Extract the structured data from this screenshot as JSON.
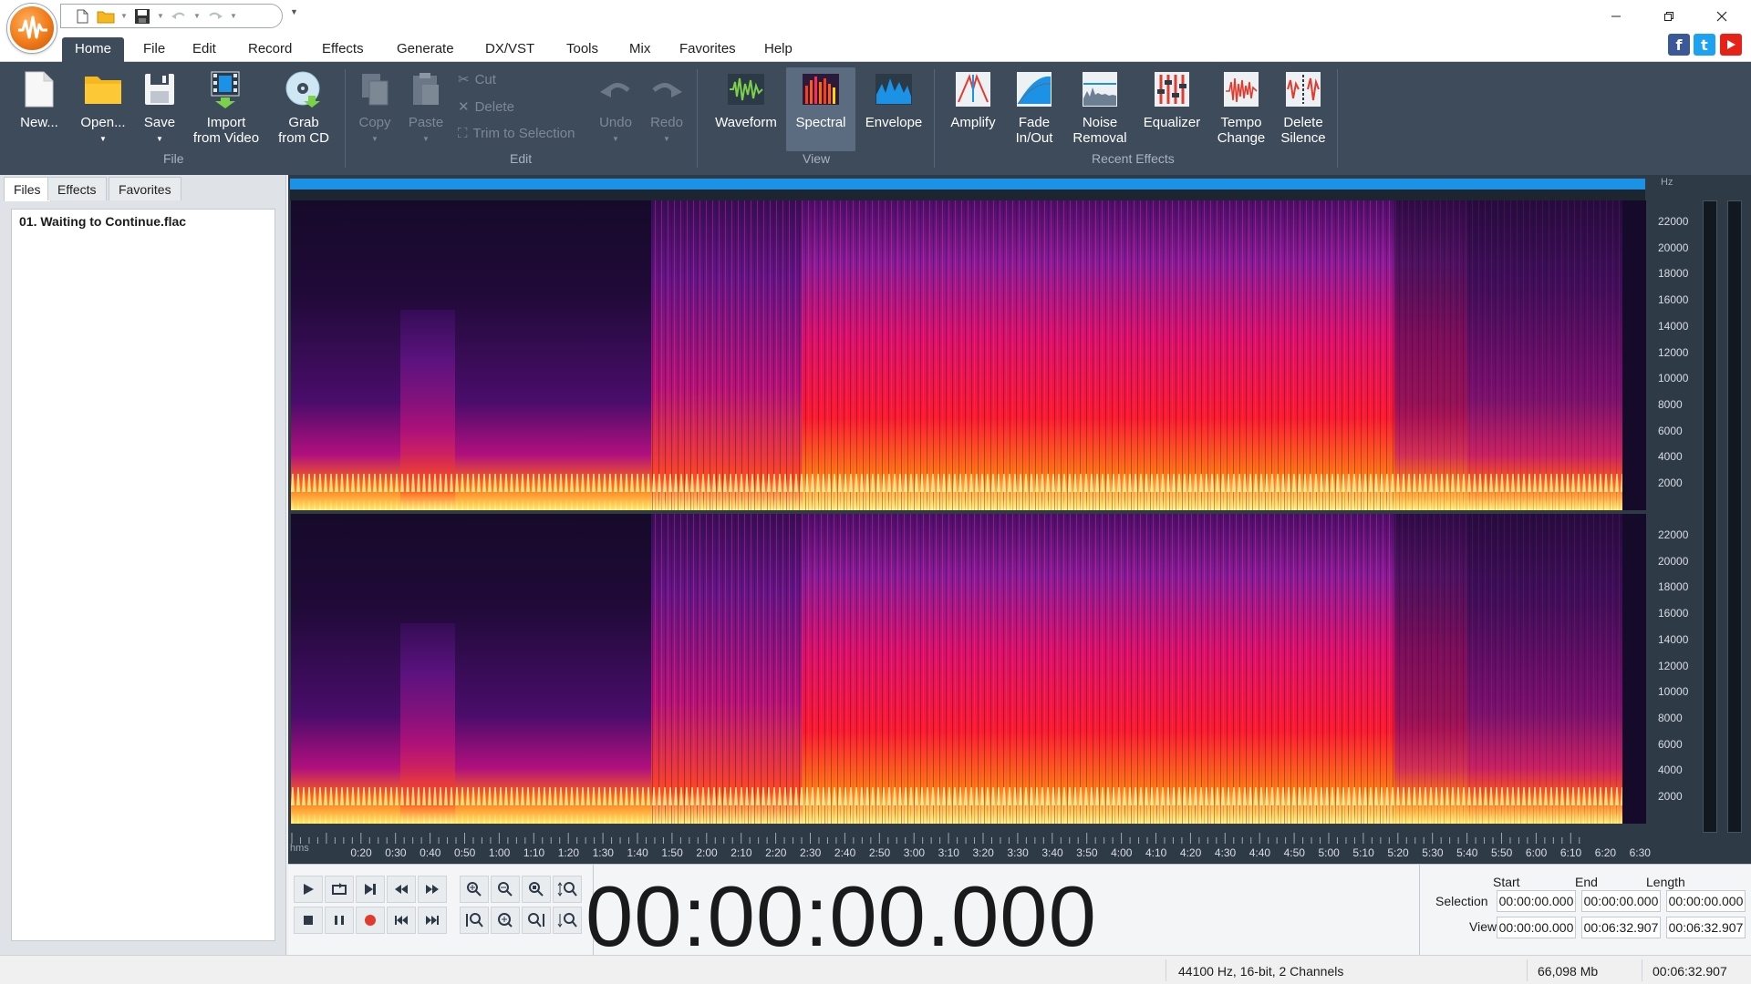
{
  "titlebar": {
    "qat_icons": [
      "new-file-icon",
      "open-folder-icon",
      "save-icon",
      "undo-icon",
      "redo-icon"
    ],
    "controls": [
      "minimize-icon",
      "restore-icon",
      "close-icon"
    ]
  },
  "menu": {
    "tabs": [
      "Home",
      "File",
      "Edit",
      "Record",
      "Effects",
      "Generate",
      "DX/VST",
      "Tools",
      "Mix",
      "Favorites",
      "Help"
    ],
    "active": "Home",
    "social": [
      "facebook",
      "twitter",
      "youtube"
    ]
  },
  "ribbon": {
    "file_group": {
      "label": "File",
      "new": "New...",
      "open": "Open...",
      "save": "Save",
      "import_line1": "Import",
      "import_line2": "from Video",
      "grab_line1": "Grab",
      "grab_line2": "from CD"
    },
    "edit_group": {
      "label": "Edit",
      "copy": "Copy",
      "paste": "Paste",
      "cut": "Cut",
      "delete": "Delete",
      "trim": "Trim to Selection",
      "undo": "Undo",
      "redo": "Redo"
    },
    "view_group": {
      "label": "View",
      "waveform": "Waveform",
      "spectral": "Spectral",
      "envelope": "Envelope",
      "active": "Spectral"
    },
    "effects_group": {
      "label": "Recent Effects",
      "amplify": "Amplify",
      "fade_line1": "Fade",
      "fade_line2": "In/Out",
      "noise_line1": "Noise",
      "noise_line2": "Removal",
      "equalizer": "Equalizer",
      "tempo_line1": "Tempo",
      "tempo_line2": "Change",
      "silence_line1": "Delete",
      "silence_line2": "Silence"
    }
  },
  "left_panel": {
    "tabs": [
      "Files",
      "Effects",
      "Favorites"
    ],
    "active_tab": "Files",
    "files": [
      "01. Waiting to Continue.flac"
    ]
  },
  "editor": {
    "view_mode": "Spectral",
    "freq_unit": "Hz",
    "freq_ticks": [
      "22000",
      "20000",
      "18000",
      "16000",
      "14000",
      "12000",
      "10000",
      "8000",
      "6000",
      "4000",
      "2000"
    ],
    "time_unit": "hms",
    "time_ticks": [
      "0:20",
      "0:30",
      "0:40",
      "0:50",
      "1:00",
      "1:10",
      "1:20",
      "1:30",
      "1:40",
      "1:50",
      "2:00",
      "2:10",
      "2:20",
      "2:30",
      "2:40",
      "2:50",
      "3:00",
      "3:10",
      "3:20",
      "3:30",
      "3:40",
      "3:50",
      "4:00",
      "4:10",
      "4:20",
      "4:30",
      "4:40",
      "4:50",
      "5:00",
      "5:10",
      "5:20",
      "5:30",
      "5:40",
      "5:50",
      "6:00",
      "6:10",
      "6:20",
      "6:30"
    ],
    "channels": 2,
    "colors": {
      "background": "#2f3a47",
      "overview_bar": "#1b92e6",
      "spectrum_low": "#1a0b2e",
      "spectrum_mid": "#ff1a1a",
      "spectrum_high": "#fff27a"
    }
  },
  "transport": {
    "time": "00:00:00.000",
    "buttons_row1": [
      "play-icon",
      "loop-icon",
      "play-to-end-icon",
      "rewind-icon",
      "fast-forward-icon"
    ],
    "buttons_row2": [
      "stop-icon",
      "pause-icon",
      "record-icon",
      "go-to-start-icon",
      "go-to-end-icon"
    ],
    "zoom_row1": [
      "zoom-in-icon",
      "zoom-out-icon",
      "zoom-selection-icon",
      "zoom-vertical-in-icon"
    ],
    "zoom_row2": [
      "zoom-fit-icon",
      "zoom-full-icon",
      "zoom-to-end-icon",
      "zoom-vertical-out-icon"
    ]
  },
  "selection": {
    "headers": {
      "start": "Start",
      "end": "End",
      "length": "Length"
    },
    "selection_label": "Selection",
    "view_label": "View",
    "selection_start": "00:00:00.000",
    "selection_end": "00:00:00.000",
    "selection_length": "00:00:00.000",
    "view_start": "00:00:00.000",
    "view_end": "00:06:32.907",
    "view_length": "00:06:32.907"
  },
  "status": {
    "format": "44100 Hz, 16-bit, 2 Channels",
    "size": "66,098 Mb",
    "duration": "00:06:32.907"
  }
}
